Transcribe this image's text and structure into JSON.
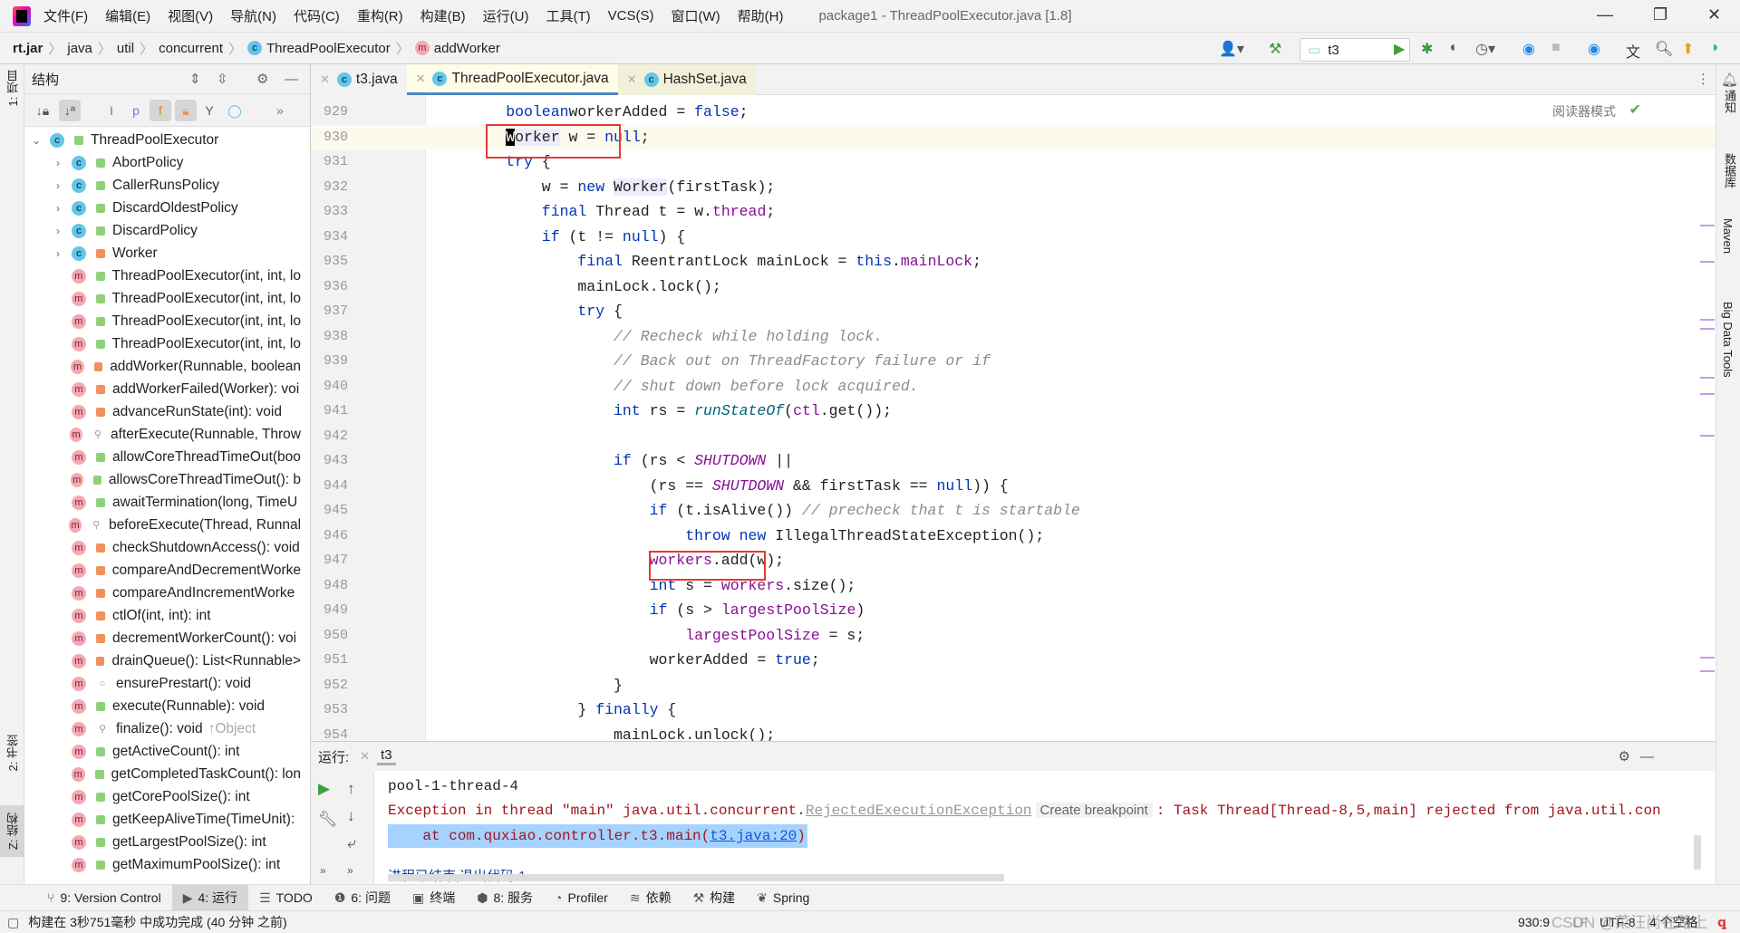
{
  "window": {
    "title": "package1 - ThreadPoolExecutor.java [1.8]",
    "controls": [
      "—",
      "❐",
      "✕"
    ]
  },
  "menu": [
    "文件(F)",
    "编辑(E)",
    "视图(V)",
    "导航(N)",
    "代码(C)",
    "重构(R)",
    "构建(B)",
    "运行(U)",
    "工具(T)",
    "VCS(S)",
    "窗口(W)",
    "帮助(H)"
  ],
  "breadcrumb": [
    {
      "label": "rt.jar",
      "bold": true
    },
    {
      "label": "java"
    },
    {
      "label": "util"
    },
    {
      "label": "concurrent"
    },
    {
      "label": "ThreadPoolExecutor",
      "icon": "class"
    },
    {
      "label": "addWorker",
      "icon": "method"
    }
  ],
  "run_config": {
    "selected": "t3"
  },
  "left_strip": {
    "project": "1: 项目",
    "bookmarks": "2: 书签",
    "structure": "Z: 结构"
  },
  "right_strip": [
    "通知",
    "数据库",
    "Maven",
    "Big Data Tools"
  ],
  "structure": {
    "title": "结构",
    "items": [
      {
        "text": "ThreadPoolExecutor",
        "kind": "c",
        "acc": "pub",
        "arrow": "open",
        "level": 0
      },
      {
        "text": "AbortPolicy",
        "kind": "c",
        "acc": "pub",
        "arrow": "closed",
        "level": 1
      },
      {
        "text": "CallerRunsPolicy",
        "kind": "c",
        "acc": "pub",
        "arrow": "closed",
        "level": 1
      },
      {
        "text": "DiscardOldestPolicy",
        "kind": "c",
        "acc": "pub",
        "arrow": "closed",
        "level": 1
      },
      {
        "text": "DiscardPolicy",
        "kind": "c",
        "acc": "pub",
        "arrow": "closed",
        "level": 1
      },
      {
        "text": "Worker",
        "kind": "c",
        "acc": "priv",
        "arrow": "closed",
        "level": 1
      },
      {
        "text": "ThreadPoolExecutor(int, int, lo",
        "kind": "m",
        "acc": "pub",
        "level": 1
      },
      {
        "text": "ThreadPoolExecutor(int, int, lo",
        "kind": "m",
        "acc": "pub",
        "level": 1
      },
      {
        "text": "ThreadPoolExecutor(int, int, lo",
        "kind": "m",
        "acc": "pub",
        "level": 1
      },
      {
        "text": "ThreadPoolExecutor(int, int, lo",
        "kind": "m",
        "acc": "pub",
        "level": 1
      },
      {
        "text": "addWorker(Runnable, boolean",
        "kind": "m",
        "acc": "priv",
        "level": 1
      },
      {
        "text": "addWorkerFailed(Worker): voi",
        "kind": "m",
        "acc": "priv",
        "level": 1
      },
      {
        "text": "advanceRunState(int): void",
        "kind": "m",
        "acc": "priv",
        "level": 1
      },
      {
        "text": "afterExecute(Runnable, Throw",
        "kind": "m",
        "acc": "prot",
        "level": 1
      },
      {
        "text": "allowCoreThreadTimeOut(boo",
        "kind": "m",
        "acc": "pub",
        "level": 1
      },
      {
        "text": "allowsCoreThreadTimeOut(): b",
        "kind": "m",
        "acc": "pub",
        "level": 1
      },
      {
        "text": "awaitTermination(long, TimeU",
        "kind": "m",
        "acc": "pub",
        "level": 1
      },
      {
        "text": "beforeExecute(Thread, Runnal",
        "kind": "m",
        "acc": "prot",
        "level": 1
      },
      {
        "text": "checkShutdownAccess(): void",
        "kind": "m",
        "acc": "priv",
        "level": 1
      },
      {
        "text": "compareAndDecrementWorke",
        "kind": "m",
        "acc": "priv",
        "level": 1
      },
      {
        "text": "compareAndIncrementWorke",
        "kind": "m",
        "acc": "priv",
        "level": 1
      },
      {
        "text": "ctlOf(int, int): int",
        "kind": "m",
        "acc": "priv",
        "level": 1
      },
      {
        "text": "decrementWorkerCount(): voi",
        "kind": "m",
        "acc": "priv",
        "level": 1
      },
      {
        "text": "drainQueue(): List<Runnable>",
        "kind": "m",
        "acc": "priv",
        "level": 1
      },
      {
        "text": "ensurePrestart(): void",
        "kind": "m",
        "acc": "pkg",
        "level": 1
      },
      {
        "text": "execute(Runnable): void",
        "kind": "m",
        "acc": "pub",
        "level": 1
      },
      {
        "text": "finalize(): void",
        "kind": "m",
        "acc": "prot",
        "level": 1,
        "inherited": "↑Object"
      },
      {
        "text": "getActiveCount(): int",
        "kind": "m",
        "acc": "pub",
        "level": 1
      },
      {
        "text": "getCompletedTaskCount(): lon",
        "kind": "m",
        "acc": "pub",
        "level": 1
      },
      {
        "text": "getCorePoolSize(): int",
        "kind": "m",
        "acc": "pub",
        "level": 1
      },
      {
        "text": "getKeepAliveTime(TimeUnit):",
        "kind": "m",
        "acc": "pub",
        "level": 1
      },
      {
        "text": "getLargestPoolSize(): int",
        "kind": "m",
        "acc": "pub",
        "level": 1
      },
      {
        "text": "getMaximumPoolSize(): int",
        "kind": "m",
        "acc": "pub",
        "level": 1
      }
    ]
  },
  "tabs": [
    {
      "label": "t3.java",
      "cls": "t3"
    },
    {
      "label": "ThreadPoolExecutor.java",
      "cls": "active"
    },
    {
      "label": "HashSet.java",
      "cls": "hs"
    }
  ],
  "editor": {
    "reader_mode": "阅读器模式",
    "current_line": 930,
    "lines": [
      {
        "n": 929,
        "i": 8,
        "t": [
          [
            "kw",
            "boolean"
          ],
          [
            "",
            "workerAdded = "
          ],
          [
            "kw",
            "false"
          ],
          [
            "",
            ";"
          ]
        ]
      },
      {
        "n": 930,
        "i": 8,
        "t": [
          [
            "caret",
            "W"
          ],
          [
            "hl",
            "orker"
          ],
          [
            "",
            " w = "
          ],
          [
            "kw",
            "null"
          ],
          [
            "",
            ";"
          ]
        ]
      },
      {
        "n": 931,
        "i": 8,
        "t": [
          [
            "kw",
            "try"
          ],
          [
            "",
            " {"
          ]
        ]
      },
      {
        "n": 932,
        "i": 12,
        "t": [
          [
            "",
            "w = "
          ],
          [
            "kw",
            "new "
          ],
          [
            "hl",
            "Worker"
          ],
          [
            "",
            "(firstTask);"
          ]
        ]
      },
      {
        "n": 933,
        "i": 12,
        "t": [
          [
            "kw",
            "final "
          ],
          [
            "",
            "Thread t = w."
          ],
          [
            "fld",
            "thread"
          ],
          [
            "",
            ";"
          ]
        ]
      },
      {
        "n": 934,
        "i": 12,
        "t": [
          [
            "kw",
            "if"
          ],
          [
            "",
            " (t != "
          ],
          [
            "kw",
            "null"
          ],
          [
            "",
            ") {"
          ]
        ]
      },
      {
        "n": 935,
        "i": 16,
        "t": [
          [
            "kw",
            "final "
          ],
          [
            "",
            "ReentrantLock mainLock = "
          ],
          [
            "kw",
            "this"
          ],
          [
            "",
            "."
          ],
          [
            "fld",
            "mainLock"
          ],
          [
            "",
            ";"
          ]
        ]
      },
      {
        "n": 936,
        "i": 16,
        "t": [
          [
            "",
            "mainLock.lock();"
          ]
        ]
      },
      {
        "n": 937,
        "i": 16,
        "t": [
          [
            "kw",
            "try"
          ],
          [
            "",
            " {"
          ]
        ]
      },
      {
        "n": 938,
        "i": 20,
        "t": [
          [
            "cmt",
            "// Recheck while holding lock."
          ]
        ]
      },
      {
        "n": 939,
        "i": 20,
        "t": [
          [
            "cmt",
            "// Back out on ThreadFactory failure or if"
          ]
        ]
      },
      {
        "n": 940,
        "i": 20,
        "t": [
          [
            "cmt",
            "// shut down before lock acquired."
          ]
        ]
      },
      {
        "n": 941,
        "i": 20,
        "t": [
          [
            "kw",
            "int "
          ],
          [
            "",
            "rs = "
          ],
          [
            "fn",
            "runStateOf"
          ],
          [
            "",
            "("
          ],
          [
            "fld",
            "ctl"
          ],
          [
            "",
            ".get());"
          ]
        ]
      },
      {
        "n": 942,
        "i": 0,
        "t": []
      },
      {
        "n": 943,
        "i": 20,
        "t": [
          [
            "kw",
            "if"
          ],
          [
            "",
            " (rs < "
          ],
          [
            "cst",
            "SHUTDOWN"
          ],
          [
            "",
            " ||"
          ]
        ]
      },
      {
        "n": 944,
        "i": 24,
        "t": [
          [
            "",
            "(rs == "
          ],
          [
            "cst",
            "SHUTDOWN"
          ],
          [
            "",
            " && firstTask == "
          ],
          [
            "kw",
            "null"
          ],
          [
            "",
            ")) {"
          ]
        ]
      },
      {
        "n": 945,
        "i": 24,
        "t": [
          [
            "kw",
            "if"
          ],
          [
            "",
            " (t.isAlive()) "
          ],
          [
            "cmt",
            "// precheck that t is startable"
          ]
        ]
      },
      {
        "n": 946,
        "i": 28,
        "t": [
          [
            "kw",
            "throw new "
          ],
          [
            "",
            "IllegalThreadStateException();"
          ]
        ]
      },
      {
        "n": 947,
        "i": 24,
        "t": [
          [
            "fld",
            "workers"
          ],
          [
            "",
            ".add(w);"
          ]
        ]
      },
      {
        "n": 948,
        "i": 24,
        "t": [
          [
            "kw",
            "int "
          ],
          [
            "",
            "s = "
          ],
          [
            "fld",
            "workers"
          ],
          [
            "",
            ".size();"
          ]
        ]
      },
      {
        "n": 949,
        "i": 24,
        "t": [
          [
            "kw",
            "if"
          ],
          [
            "",
            " (s > "
          ],
          [
            "fld",
            "largestPoolSize"
          ],
          [
            "",
            ")"
          ]
        ]
      },
      {
        "n": 950,
        "i": 28,
        "t": [
          [
            "fld",
            "largestPoolSize"
          ],
          [
            "",
            " = s;"
          ]
        ]
      },
      {
        "n": 951,
        "i": 24,
        "t": [
          [
            "",
            "workerAdded = "
          ],
          [
            "kw",
            "true"
          ],
          [
            "",
            ";"
          ]
        ]
      },
      {
        "n": 952,
        "i": 20,
        "t": [
          [
            "",
            "}"
          ]
        ]
      },
      {
        "n": 953,
        "i": 16,
        "t": [
          [
            "",
            "} "
          ],
          [
            "kw",
            "finally"
          ],
          [
            "",
            " {"
          ]
        ]
      },
      {
        "n": 954,
        "i": 20,
        "t": [
          [
            "",
            "mainLock.unlock();"
          ]
        ]
      }
    ]
  },
  "run": {
    "label": "运行:",
    "tab": "t3",
    "output": {
      "line1": "pool-1-thread-4",
      "exc_prefix": "Exception in thread \"main\" java.util.concurrent.",
      "exc_class": "RejectedExecutionException",
      "create_breakpoint": "Create breakpoint",
      "exc_suffix": ": Task Thread[Thread-8,5,main] rejected from java.util.con",
      "at_prefix": "    at com.quxiao.controller.t3.main(",
      "at_link": "t3.java:20",
      "at_suffix": ")",
      "finished": "进程已结束,退出代码-1"
    }
  },
  "bottom_tools": [
    {
      "label": "9: Version Control",
      "icon": "⑂"
    },
    {
      "label": "4: 运行",
      "icon": "▶",
      "active": true
    },
    {
      "label": "TODO",
      "icon": "☰"
    },
    {
      "label": "6: 问题",
      "icon": "❶"
    },
    {
      "label": "终端",
      "icon": "▣"
    },
    {
      "label": "8: 服务",
      "icon": "⬢"
    },
    {
      "label": "Profiler",
      "icon": "◔"
    },
    {
      "label": "依赖",
      "icon": "≋"
    },
    {
      "label": "构建",
      "icon": "⚒"
    },
    {
      "label": "Spring",
      "icon": "❦"
    }
  ],
  "status": {
    "message": "构建在 3秒751毫秒 中成功完成 (40 分钟 之前)",
    "position": "930:9",
    "line_sep": "LF",
    "encoding": "UTF-8",
    "indent": "4 个空格"
  },
  "watermark": "CSDN @菜汪尚在路上"
}
